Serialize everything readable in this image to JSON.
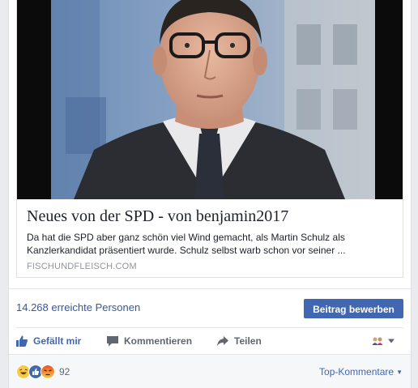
{
  "link_preview": {
    "title": "Neues von der SPD - von benjamin2017",
    "description": "Da hat die SPD aber ganz schön viel Wind gemacht, als Martin Schulz als Kanzlerkandidat präsentiert wurde. Schulz selbst warb schon vor seiner ...",
    "domain": "FISCHUNDFLEISCH.COM"
  },
  "insights": {
    "reach_text": "14.268 erreichte Personen",
    "boost_label": "Beitrag bewerben"
  },
  "actions": {
    "like_label": "Gefällt mir",
    "comment_label": "Kommentieren",
    "share_label": "Teilen"
  },
  "reactions": {
    "icons": [
      "haha-icon",
      "like-icon",
      "angry-icon"
    ],
    "count": "92"
  },
  "comments_sort": {
    "label": "Top-Kommentare"
  },
  "colors": {
    "brand_blue": "#4267b2",
    "link_blue": "#365899",
    "text": "#1d2129",
    "muted": "#90949c"
  }
}
